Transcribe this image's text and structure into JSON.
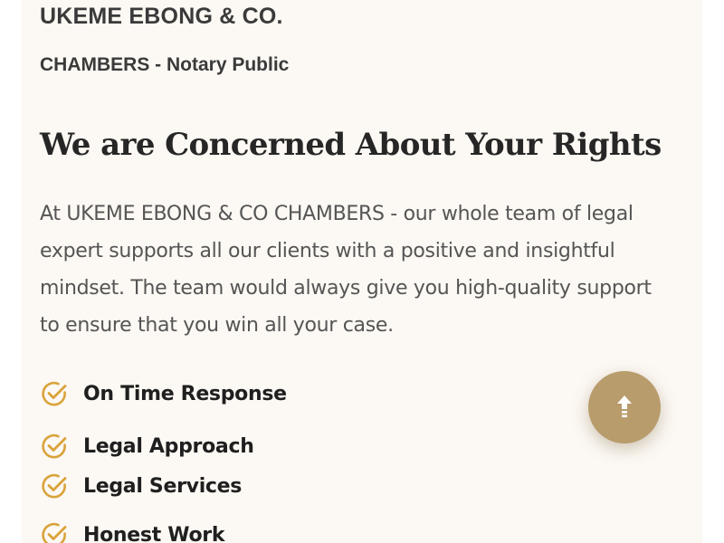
{
  "header": {
    "firm_name": "UKEME EBONG & CO.",
    "firm_subtitle": "CHAMBERS - Notary Public"
  },
  "main": {
    "headline": "We are Concerned About Your Rights",
    "intro": "At UKEME EBONG & CO CHAMBERS - our whole team of legal expert supports all our clients with a positive and insightful mindset. The team would always give you high-quality support to ensure that you win all your case.",
    "features": [
      {
        "label": "On Time Response",
        "icon": "check-circle-icon"
      },
      {
        "label": "Legal Approach",
        "icon": "check-circle-icon"
      },
      {
        "label": "Legal Services",
        "icon": "check-circle-icon"
      },
      {
        "label": "Honest Work",
        "icon": "check-circle-icon"
      }
    ]
  },
  "scroll_top": {
    "icon": "arrow-up-icon"
  },
  "colors": {
    "accent": "#b89c6c",
    "check": "#d9a33a",
    "card_background": "#fcf8f3",
    "heading": "#262626",
    "body_text": "#555555"
  }
}
